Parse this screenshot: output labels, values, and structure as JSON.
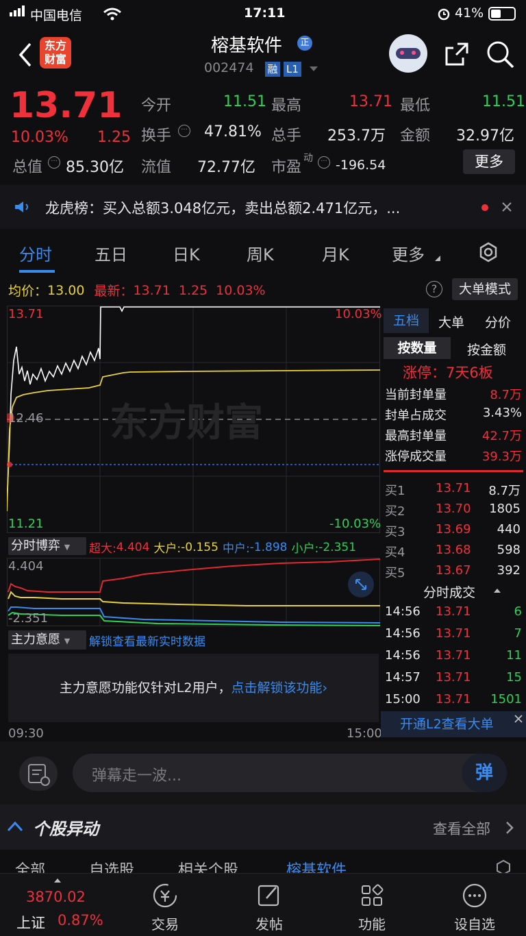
{
  "status": {
    "carrier": "中国电信",
    "time": "17:11",
    "battery": "41%"
  },
  "header": {
    "title": "榕基软件",
    "code": "002474",
    "badge_rong": "融",
    "badge_l1": "L1",
    "logo_text_1": "东方",
    "logo_text_2": "财富"
  },
  "quote": {
    "price": "13.71",
    "change_pct": "10.03%",
    "change": "1.25",
    "open_label": "今开",
    "open": "11.51",
    "high_label": "最高",
    "high": "13.71",
    "low_label": "最低",
    "low": "11.51",
    "turnover_label": "换手",
    "turnover": "47.81%",
    "volume_label": "总手",
    "volume": "253.7万",
    "amount_label": "金额",
    "amount": "32.97亿",
    "mcap_label": "总值",
    "mcap": "85.30亿",
    "float_label": "流值",
    "float": "72.77亿",
    "pe_label": "市盈",
    "pe_sup": "动",
    "pe": "-196.54",
    "more": "更多"
  },
  "lhb": {
    "text": "龙虎榜：买入总额3.048亿元，卖出总额2.471亿元，..."
  },
  "tabs": [
    "分时",
    "五日",
    "日K",
    "周K",
    "月K",
    "更多"
  ],
  "info_bar": {
    "avg_label": "均价：",
    "avg": "13.00",
    "latest_label": "最新：",
    "latest": "13.71",
    "chg": "1.25",
    "pct": "10.03%",
    "mode": "大单模式"
  },
  "chart": {
    "top_left": "13.71",
    "top_right": "10.03%",
    "mid": "12.46",
    "bot_left": "11.21",
    "bot_right": "-10.03%",
    "watermark": "东方财富",
    "time_start": "09:30",
    "time_end": "15:00"
  },
  "flow": {
    "label": "分时博弈",
    "super_label": "超大:",
    "super": "4.404",
    "big_label": "大户:",
    "big": "-0.155",
    "mid_label": "中户:",
    "mid": "-1.898",
    "small_label": "小户:",
    "small": "-2.351",
    "top": "4.404",
    "bottom": "-2.351"
  },
  "intent": {
    "label": "主力意愿",
    "link": "解锁查看最新实时数据",
    "msg": "主力意愿功能仅针对L2用户，",
    "msg_link": "点击解锁该功能"
  },
  "side": {
    "tabs": [
      "五档",
      "大单",
      "分价"
    ],
    "sub_tabs": [
      "按数量",
      "按金额"
    ],
    "limit_title": "涨停：7天6板",
    "stats": [
      {
        "label": "当前封单量",
        "value": "8.7万"
      },
      {
        "label": "封单占成交",
        "value": "3.43%"
      },
      {
        "label": "最高封单量",
        "value": "42.7万"
      },
      {
        "label": "涨停成交量",
        "value": "39.3万"
      }
    ],
    "bids": [
      {
        "label": "买1",
        "price": "13.71",
        "vol": "8.7万"
      },
      {
        "label": "买2",
        "price": "13.70",
        "vol": "1805"
      },
      {
        "label": "买3",
        "price": "13.69",
        "vol": "440"
      },
      {
        "label": "买4",
        "price": "13.68",
        "vol": "598"
      },
      {
        "label": "买5",
        "price": "13.67",
        "vol": "392"
      }
    ],
    "trades_title": "分时成交",
    "trades": [
      {
        "time": "14:56",
        "price": "13.71",
        "vol": "6"
      },
      {
        "time": "14:56",
        "price": "13.71",
        "vol": "7"
      },
      {
        "time": "14:56",
        "price": "13.71",
        "vol": "11"
      },
      {
        "time": "14:57",
        "price": "13.71",
        "vol": "15"
      },
      {
        "time": "15:00",
        "price": "13.71",
        "vol": "1501"
      }
    ],
    "l2_banner": "开通L2查看大单"
  },
  "danmu": {
    "placeholder": "弹幕走一波...",
    "send": "弹"
  },
  "yidong": {
    "title": "个股异动",
    "view_all": "查看全部",
    "sub_tabs": [
      "全部",
      "自选股",
      "相关个股",
      "榕基软件"
    ]
  },
  "bottom": {
    "index_value": "3870.02",
    "index_name": "上证",
    "index_pct": "0.87%",
    "items": [
      "交易",
      "发帖",
      "功能",
      "设自选"
    ]
  },
  "colors": {
    "up": "#f0303a",
    "down": "#2fd05a",
    "avg_line": "#e9d23c",
    "price_line": "#ffffff",
    "accent": "#3a8bf0"
  }
}
